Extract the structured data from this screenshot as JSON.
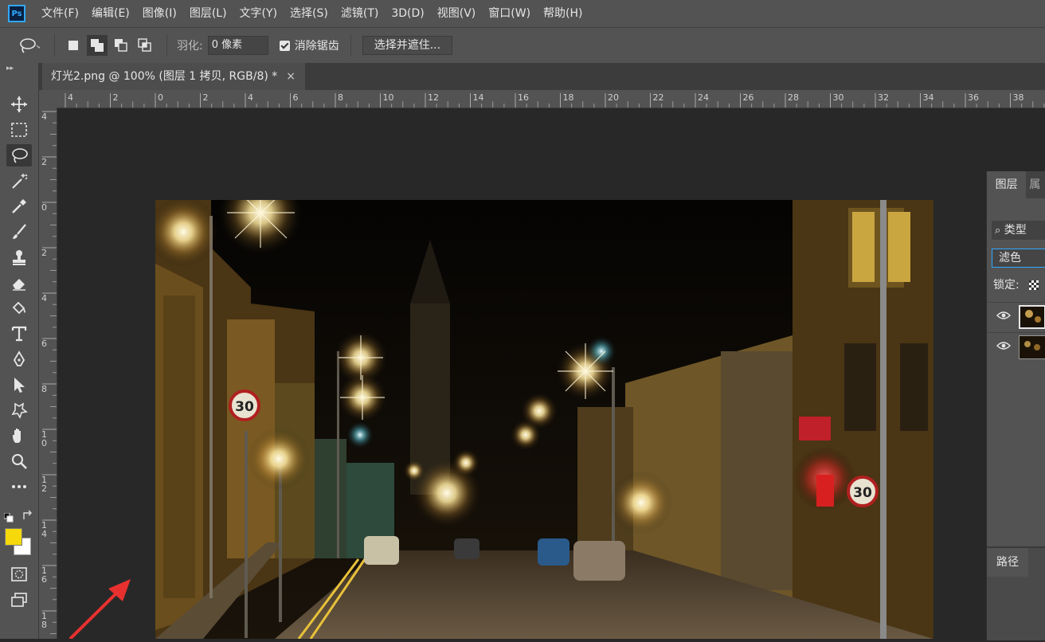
{
  "menubar": {
    "logo": "Ps",
    "items": [
      "文件(F)",
      "编辑(E)",
      "图像(I)",
      "图层(L)",
      "文字(Y)",
      "选择(S)",
      "滤镜(T)",
      "3D(D)",
      "视图(V)",
      "窗口(W)",
      "帮助(H)"
    ]
  },
  "options": {
    "feather_label": "羽化:",
    "feather_value": "0 像素",
    "antialias_label": "消除锯齿",
    "select_mask_button": "选择并遮住..."
  },
  "document": {
    "tab_title": "灯光2.png @ 100% (图层 1 拷贝, RGB/8) *",
    "close": "×"
  },
  "ruler": {
    "h_labels": [
      "4",
      "2",
      "0",
      "2",
      "4",
      "6",
      "8",
      "10",
      "12",
      "14",
      "16",
      "18",
      "20",
      "22",
      "24",
      "26",
      "28",
      "30",
      "32",
      "34",
      "36",
      "38"
    ],
    "v_labels": [
      "4",
      "2",
      "0",
      "2",
      "4",
      "6",
      "8",
      "1\n0",
      "1\n2",
      "1\n4",
      "1\n6",
      "1\n8"
    ]
  },
  "colors": {
    "foreground": "#f5d90a",
    "background": "#ffffff",
    "accent": "#31a8ff",
    "arrow": "#e8312f"
  },
  "layers_panel": {
    "tab_layers": "图层",
    "tab_partial": "属",
    "filter_label": "类型",
    "blend_mode": "滤色",
    "lock_label": "锁定:",
    "paths_tab": "路径"
  },
  "photo": {
    "sign_speed": "30"
  }
}
